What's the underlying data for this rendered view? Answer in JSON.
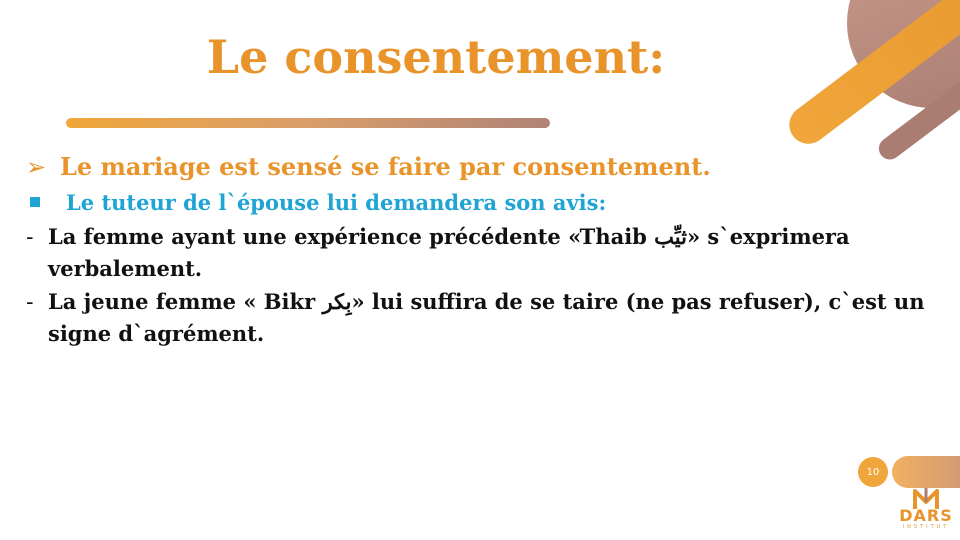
{
  "slide": {
    "title": "Le consentement:",
    "items": [
      {
        "level": 1,
        "text": "Le mariage est sensé se faire par consentement."
      },
      {
        "level": 2,
        "text": "Le tuteur de l`épouse lui demandera son avis:"
      }
    ],
    "dash_items": [
      {
        "text": "La femme ayant une expérience précédente  «Thaib ثيِّب» s`exprimera verbalement."
      },
      {
        "text": "La jeune femme « Bikr بِكر» lui suffira de se taire (ne pas refuser), c`est un signe d`agrément."
      }
    ],
    "page_number": "10"
  },
  "logo": {
    "text": "DARS",
    "subtext": "INSTITUT"
  },
  "colors": {
    "accent_orange": "#e8942b",
    "accent_blue": "#1fa4d4",
    "accent_brown": "#a97d72"
  }
}
